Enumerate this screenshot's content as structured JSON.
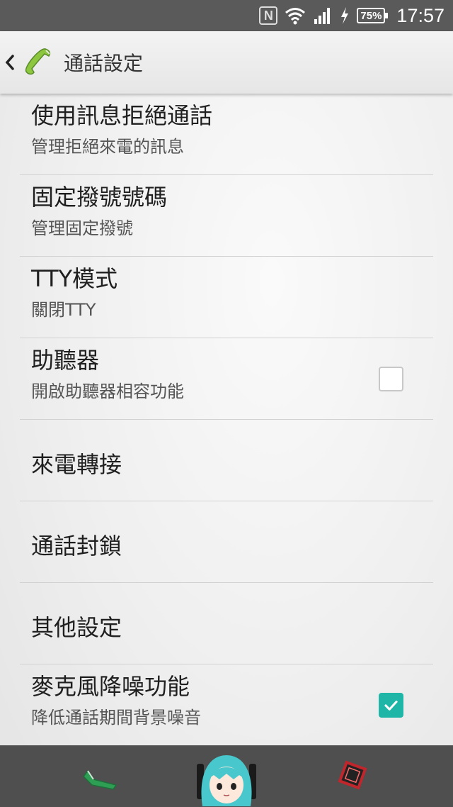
{
  "status_bar": {
    "nfc_label": "N",
    "battery_text": "75%",
    "time": "17:57",
    "icons": [
      "nfc-icon",
      "wifi-icon",
      "signal-icon",
      "charging-icon",
      "battery-icon"
    ]
  },
  "header": {
    "title": "通話設定",
    "icons": [
      "back-icon",
      "phone-handset-icon"
    ]
  },
  "settings": {
    "items": [
      {
        "title": "使用訊息拒絕通話",
        "summary": "管理拒絕來電的訊息"
      },
      {
        "title": "固定撥號號碼",
        "summary": "管理固定撥號"
      },
      {
        "title": "TTY模式",
        "summary": "關閉TTY"
      },
      {
        "title": "助聽器",
        "summary": "開啟助聽器相容功能",
        "checked": false
      },
      {
        "title": "來電轉接"
      },
      {
        "title": "通話封鎖"
      },
      {
        "title": "其他設定"
      },
      {
        "title": "麥克風降噪功能",
        "summary": "降低通話期間背景噪音",
        "checked": true
      }
    ]
  },
  "nav_bar": {
    "icons": [
      "back-icon",
      "home-icon",
      "recent-apps-icon"
    ]
  },
  "colors": {
    "accent": "#1fb6a8",
    "status_bar": "#5a5a5a",
    "nav_bar": "#4f4f4f"
  }
}
